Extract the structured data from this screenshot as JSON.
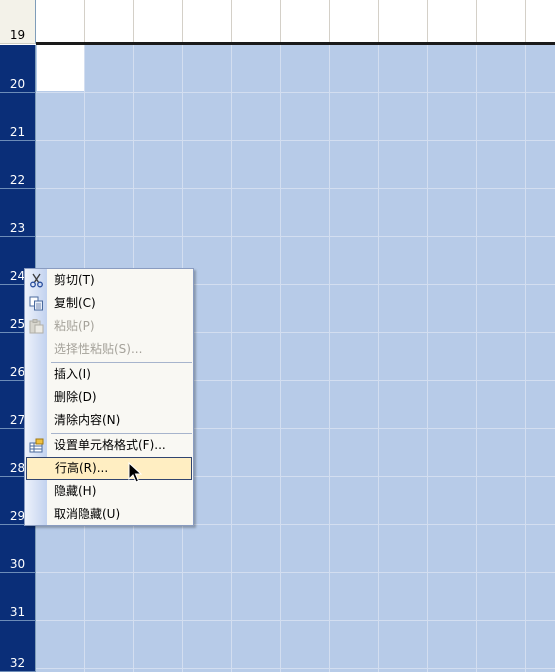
{
  "sheet": {
    "rows": [
      {
        "number": "19",
        "selected": false
      },
      {
        "number": "20",
        "selected": true
      },
      {
        "number": "21",
        "selected": true
      },
      {
        "number": "22",
        "selected": true
      },
      {
        "number": "23",
        "selected": true
      },
      {
        "number": "24",
        "selected": true
      },
      {
        "number": "25",
        "selected": true
      },
      {
        "number": "26",
        "selected": true
      },
      {
        "number": "27",
        "selected": true
      },
      {
        "number": "28",
        "selected": true
      },
      {
        "number": "29",
        "selected": true
      },
      {
        "number": "30",
        "selected": true
      },
      {
        "number": "31",
        "selected": true
      },
      {
        "number": "32",
        "selected": true
      }
    ],
    "colors": {
      "selected_header": "#0a2e78",
      "selected_cells": "#b7cbe8",
      "menu_highlight": "#ffeec2"
    }
  },
  "context_menu": {
    "items": [
      {
        "label": "剪切(T)",
        "icon": "scissors-icon",
        "enabled": true
      },
      {
        "label": "复制(C)",
        "icon": "copy-icon",
        "enabled": true
      },
      {
        "label": "粘贴(P)",
        "icon": "paste-icon",
        "enabled": false
      },
      {
        "label": "选择性粘贴(S)...",
        "icon": "",
        "enabled": false
      },
      {
        "label": "插入(I)",
        "icon": "",
        "enabled": true
      },
      {
        "label": "删除(D)",
        "icon": "",
        "enabled": true
      },
      {
        "label": "清除内容(N)",
        "icon": "",
        "enabled": true
      },
      {
        "label": "设置单元格格式(F)...",
        "icon": "format-cells-icon",
        "enabled": true
      },
      {
        "label": "行高(R)...",
        "icon": "",
        "enabled": true,
        "highlighted": true
      },
      {
        "label": "隐藏(H)",
        "icon": "",
        "enabled": true
      },
      {
        "label": "取消隐藏(U)",
        "icon": "",
        "enabled": true
      }
    ]
  }
}
